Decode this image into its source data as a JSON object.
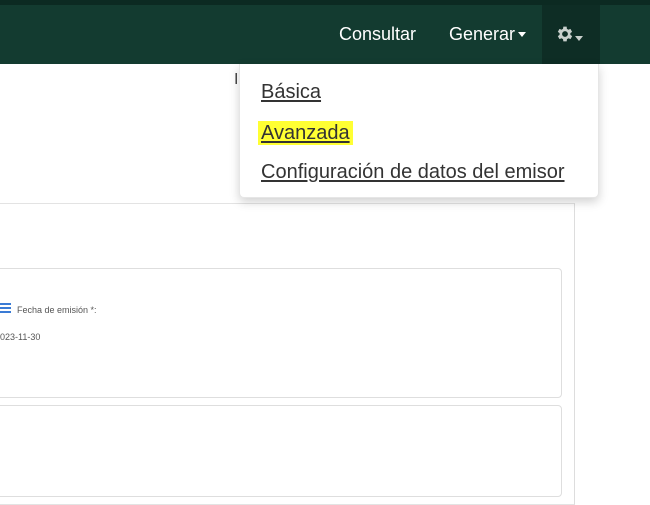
{
  "navbar": {
    "consultar": "Consultar",
    "generar": "Generar",
    "settings_icon": "gear-icon",
    "bg_color": "#133b30"
  },
  "dropdown": {
    "items": [
      {
        "label": "Básica"
      },
      {
        "label": "Avanzada",
        "highlight": "#ffff33"
      },
      {
        "label": "Configuración de datos del emisor"
      }
    ]
  },
  "partial_text": "I",
  "form": {
    "field_label": "Fecha de emisión *:",
    "field_value": "023-11-30",
    "field_icon": "list-icon"
  }
}
